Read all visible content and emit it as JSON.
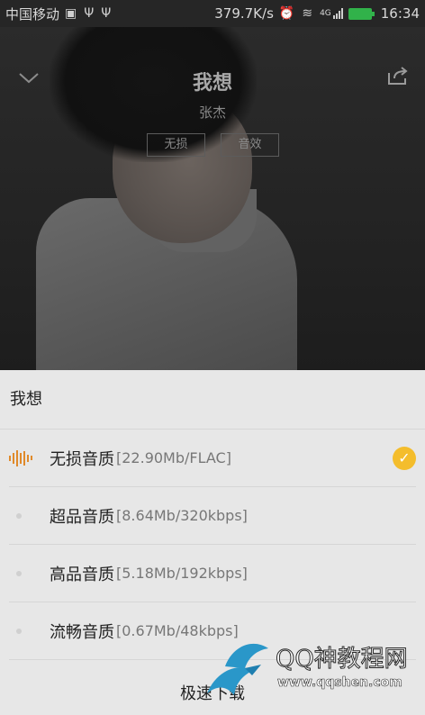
{
  "status_bar": {
    "carrier": "中国移动",
    "net_speed": "379.7K/s",
    "time": "16:34",
    "network_type": "4G"
  },
  "player": {
    "song_title": "我想",
    "artist": "张杰",
    "tag_lossless": "无损",
    "tag_effects": "音效"
  },
  "sheet": {
    "title": "我想",
    "options": [
      {
        "name": "无损音质",
        "size": "[22.90Mb/FLAC]",
        "selected": true
      },
      {
        "name": "超品音质",
        "size": "[8.64Mb/320kbps]",
        "selected": false
      },
      {
        "name": "高品音质",
        "size": "[5.18Mb/192kbps]",
        "selected": false
      },
      {
        "name": "流畅音质",
        "size": "[0.67Mb/48kbps]",
        "selected": false
      }
    ],
    "download_label": "极速下载"
  },
  "watermark": {
    "brand": "QQ神教程网",
    "domain": "www.qqshen.com"
  },
  "colors": {
    "accent_check": "#f4bd2c",
    "wave_icon": "#e08a2a",
    "battery": "#31b24a"
  }
}
